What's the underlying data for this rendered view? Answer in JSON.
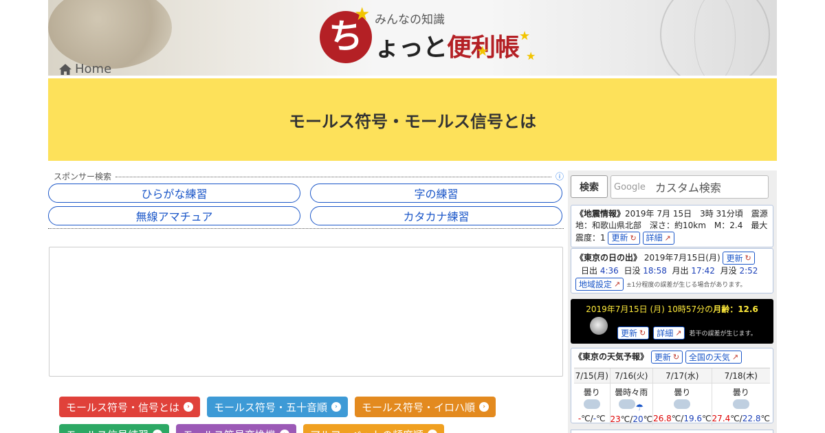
{
  "header": {
    "logo_kanji": "ち",
    "logo_sub": "みんなの知識",
    "logo_main_black": "ょっと",
    "logo_main_red": "便利帳",
    "home_label": "Home"
  },
  "page": {
    "title": "モールス符号・モールス信号とは"
  },
  "sponsor": {
    "label": "スポンサー検索",
    "info_icon": "info-icon",
    "links": [
      "ひらがな練習",
      "字の練習",
      "無線アマチュア",
      "カタカナ練習"
    ]
  },
  "tags": [
    {
      "label": "モールス符号・信号とは",
      "color": "#e0413a"
    },
    {
      "label": "モールス符号・五十音順",
      "color": "#3d9ad6"
    },
    {
      "label": "モールス符号・イロハ順",
      "color": "#e38a1f"
    },
    {
      "label": "モールス信号練習",
      "color": "#2ca864"
    },
    {
      "label": "モールス符号変換機",
      "color": "#9b59b6"
    },
    {
      "label": "アルファベットの頻度順",
      "color": "#f0a020"
    }
  ],
  "sidebar": {
    "search_button": "検索",
    "search_brand": "Google",
    "search_placeholder": "カスタム検索",
    "quake": {
      "heading": "《地震情報》",
      "text1": "2019年 7月 15日　3時 31分頃　震源地：和歌山県北部　深さ：約10km　M：2.4　最大震度：1",
      "update": "更新",
      "detail": "詳細"
    },
    "sunrise": {
      "heading": "《東京の日の出》",
      "date": "2019年7月15日(月)",
      "update": "更新",
      "sunrise_label": "日出",
      "sunrise": "4:36",
      "sunset_label": "日没",
      "sunset": "18:58",
      "moonrise_label": "月出",
      "moonrise": "17:42",
      "moonset_label": "月没",
      "moonset": "2:52",
      "region": "地域設定",
      "note": "±1分程度の誤差が生じる場合があります。"
    },
    "moon": {
      "text": "2019年7月15日 (月) 10時57分の",
      "age_label": "月齢：12.6",
      "update": "更新",
      "detail": "詳細",
      "note": "若干の誤差が生じます。"
    },
    "weather": {
      "heading": "《東京の天気予報》",
      "update": "更新",
      "national": "全国の天気",
      "days": [
        {
          "date": "7/15(月)",
          "sky": "曇り",
          "hi": "-",
          "lo": "-"
        },
        {
          "date": "7/16(火)",
          "sky": "曇時々雨",
          "hi": "23",
          "lo": "20"
        },
        {
          "date": "7/17(水)",
          "sky": "曇り",
          "hi": "26.8",
          "lo": "19.6"
        },
        {
          "date": "7/18(木)",
          "sky": "曇り",
          "hi": "27.4",
          "lo": "22.8"
        }
      ]
    }
  }
}
